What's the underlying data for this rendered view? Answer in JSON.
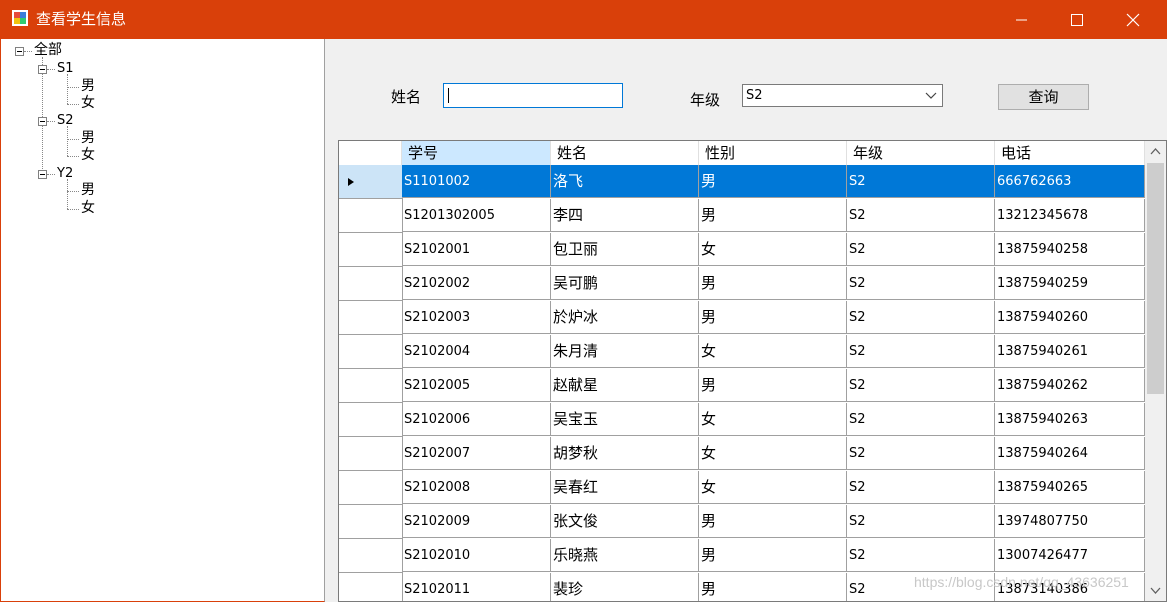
{
  "window": {
    "title": "查看学生信息",
    "accent": "#d9400a",
    "minimize_glyph": "—",
    "maximize_glyph": "☐",
    "close_glyph": "✕"
  },
  "tree": {
    "root": "全部",
    "groups": [
      {
        "label": "S1",
        "children": [
          "男",
          "女"
        ]
      },
      {
        "label": "S2",
        "children": [
          "男",
          "女"
        ]
      },
      {
        "label": "Y2",
        "children": [
          "男",
          "女"
        ]
      }
    ]
  },
  "search": {
    "name_label": "姓名",
    "name_value": "",
    "grade_label": "年级",
    "grade_value": "S2",
    "query_button": "查询"
  },
  "grid": {
    "columns": [
      "学号",
      "姓名",
      "性别",
      "年级",
      "电话"
    ],
    "selected_row": 0,
    "rows": [
      [
        "S1101002",
        "洛飞",
        "男",
        "S2",
        "666762663"
      ],
      [
        "S1201302005",
        "李四",
        "男",
        "S2",
        "13212345678"
      ],
      [
        "S2102001",
        "包卫丽",
        "女",
        "S2",
        "13875940258"
      ],
      [
        "S2102002",
        "吴可鹏",
        "男",
        "S2",
        "13875940259"
      ],
      [
        "S2102003",
        "於炉冰",
        "男",
        "S2",
        "13875940260"
      ],
      [
        "S2102004",
        "朱月清",
        "女",
        "S2",
        "13875940261"
      ],
      [
        "S2102005",
        "赵献星",
        "男",
        "S2",
        "13875940262"
      ],
      [
        "S2102006",
        "吴宝玉",
        "女",
        "S2",
        "13875940263"
      ],
      [
        "S2102007",
        "胡梦秋",
        "女",
        "S2",
        "13875940264"
      ],
      [
        "S2102008",
        "吴春红",
        "女",
        "S2",
        "13875940265"
      ],
      [
        "S2102009",
        "张文俊",
        "男",
        "S2",
        "13974807750"
      ],
      [
        "S2102010",
        "乐晓燕",
        "男",
        "S2",
        "13007426477"
      ],
      [
        "S2102011",
        "裴珍",
        "男",
        "S2",
        "13873140386"
      ]
    ]
  },
  "watermark": "https://blog.csdn.net/qq_43636251"
}
